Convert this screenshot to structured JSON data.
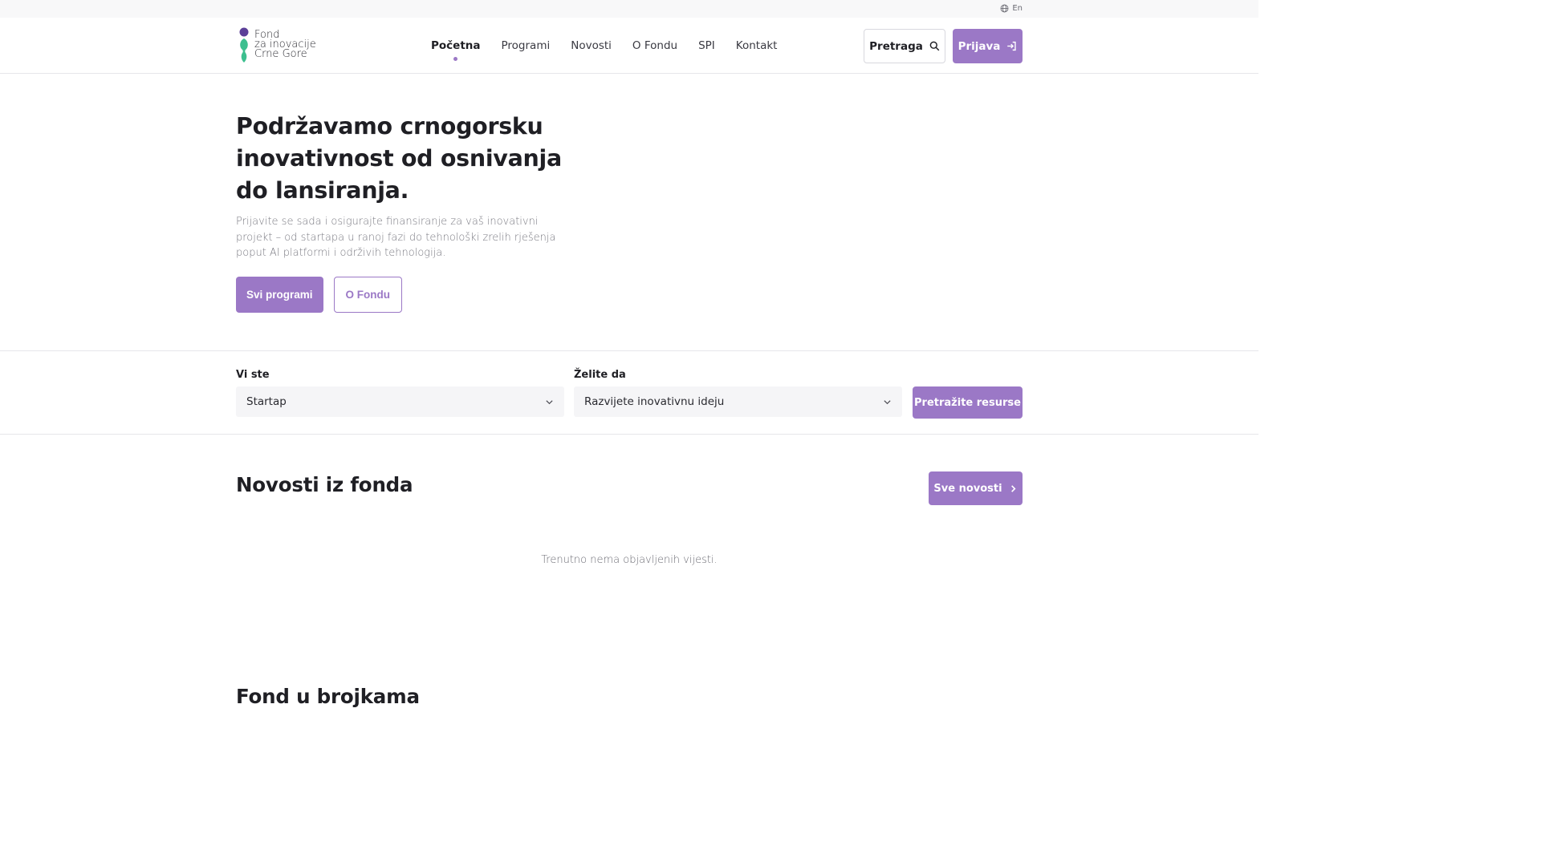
{
  "topbar": {
    "language": "En"
  },
  "brand": {
    "line1": "Fond",
    "line2": "za inovacije",
    "line3": "Crne Gore"
  },
  "nav": {
    "items": [
      {
        "label": "Početna",
        "active": true
      },
      {
        "label": "Programi"
      },
      {
        "label": "Novosti"
      },
      {
        "label": "O Fondu"
      },
      {
        "label": "SPI"
      },
      {
        "label": "Kontakt"
      }
    ]
  },
  "header": {
    "search_label": "Pretraga",
    "login_label": "Prijava"
  },
  "hero": {
    "title": "Podržavamo crnogorsku inovativnost od osnivanja do lansiranja.",
    "description": "Prijavite se sada i osigurajte finansiranje za vaš inovativni projekt – od startapa u ranoj fazi do tehnološki zrelih rješenja poput AI platformi i održivih tehnologija.",
    "primary_button": "Svi programi",
    "secondary_button": "O Fondu"
  },
  "filter": {
    "you_are_label": "Vi ste",
    "you_are_value": "Startap",
    "want_label": "Želite da",
    "want_value": "Razvijete inovativnu ideju",
    "submit_label": "Pretražite resurse"
  },
  "news": {
    "title": "Novosti iz fonda",
    "all_button": "Sve novosti",
    "empty_text": "Trenutno nema objavljenih vijesti."
  },
  "numbers": {
    "title": "Fond u brojkama"
  },
  "colors": {
    "accent": "#9b78c6",
    "logo_purple": "#5b3f98",
    "logo_green": "#3dbf8f"
  },
  "icons": [
    "globe-icon",
    "search-icon",
    "login-icon",
    "chevron-down-icon",
    "chevron-right-icon"
  ]
}
